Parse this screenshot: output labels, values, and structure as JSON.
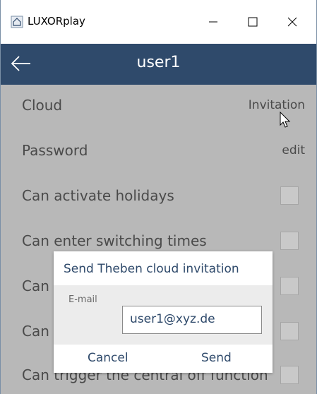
{
  "window": {
    "title": "LUXORplay",
    "minimize_icon": "minimize-icon",
    "maximize_icon": "maximize-icon",
    "close_icon": "close-icon"
  },
  "appbar": {
    "title": "user1",
    "back_icon": "back-arrow-icon"
  },
  "settings": {
    "rows": [
      {
        "label": "Cloud",
        "action": "Invitation"
      },
      {
        "label": "Password",
        "action": "edit"
      },
      {
        "label": "Can activate holidays"
      },
      {
        "label": "Can enter switching times"
      },
      {
        "label": "Can trigger the central off function"
      }
    ]
  },
  "dialog": {
    "title": "Send Theben cloud invitation",
    "field_label": "E-mail",
    "email_value": "user1@xyz.de",
    "cancel_label": "Cancel",
    "send_label": "Send"
  },
  "colors": {
    "header": "#2f4a6b",
    "dialog_text": "#2f4a6b"
  }
}
